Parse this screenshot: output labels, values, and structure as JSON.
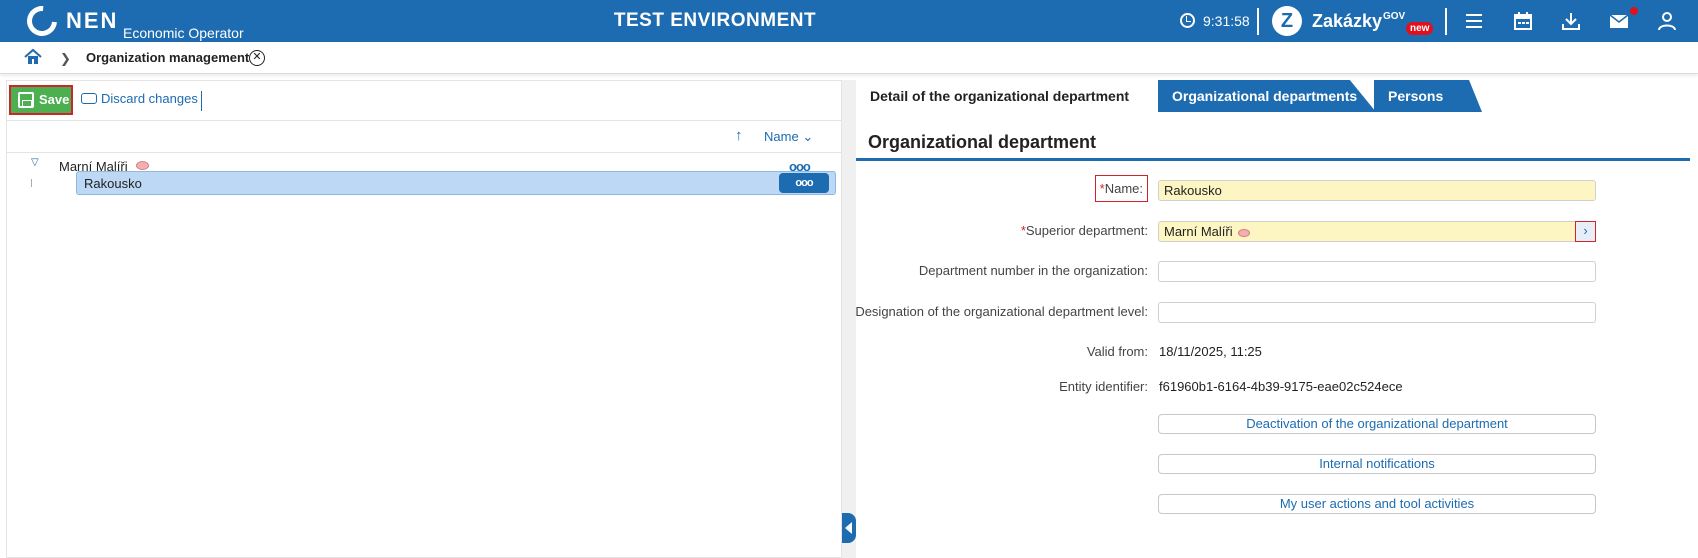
{
  "header": {
    "logo_text": "NEN",
    "logo_subtitle": "Economic Operator",
    "environment": "TEST ENVIRONMENT",
    "clock": "9:31:58",
    "zakazky_label": "Zakázky",
    "zakazky_gov": "GOV",
    "zakazky_badge": "new",
    "accent_color": "#1d6bb0",
    "icons": [
      "clock-icon",
      "zakazky-logo-icon",
      "hamburger-menu-icon",
      "calendar-icon",
      "download-icon",
      "mail-icon",
      "user-icon"
    ]
  },
  "breadcrumb": {
    "current": "Organization management"
  },
  "left_toolbar": {
    "save_label": "Save",
    "discard_label": "Discard changes"
  },
  "tree": {
    "sort_label": "Name",
    "parent": {
      "label": "Marní Malíři"
    },
    "child": {
      "label": "Rakousko"
    },
    "more_glyph": "ooo"
  },
  "tabs": [
    {
      "label": "Detail of the organizational department",
      "active": true
    },
    {
      "label": "Organizational departments",
      "active": false
    },
    {
      "label": "Persons",
      "active": false
    }
  ],
  "form": {
    "section_title": "Organizational department",
    "name_label": "Name:",
    "name_value": "Rakousko",
    "superior_label": "Superior department:",
    "superior_value": "Marní Malíři",
    "number_label": "Department number in the organization:",
    "number_value": "",
    "level_label": "Designation of the organizational department level:",
    "level_value": "",
    "valid_label": "Valid from:",
    "valid_value": "18/11/2025, 11:25",
    "entity_label": "Entity identifier:",
    "entity_value": "f61960b1-6164-4b39-9175-eae02c524ece",
    "required_mark": "*"
  },
  "actions": {
    "deactivate": "Deactivation of the organizational department",
    "notifications": "Internal notifications",
    "activities": "My user actions and tool activities"
  }
}
